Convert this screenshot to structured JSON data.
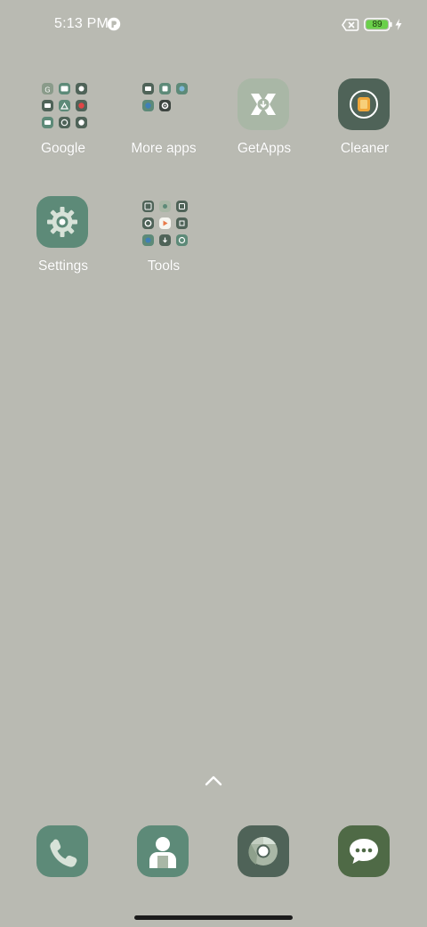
{
  "status_bar": {
    "time": "5:13 PM",
    "battery_level": "89",
    "icons": [
      "notification-icon",
      "no-sim-icon",
      "battery-icon",
      "charging-icon"
    ]
  },
  "home": {
    "apps": [
      {
        "label": "Google",
        "icon": "google-folder-icon",
        "type": "folder"
      },
      {
        "label": "More apps",
        "icon": "more-apps-folder-icon",
        "type": "folder"
      },
      {
        "label": "GetApps",
        "icon": "getapps-icon",
        "type": "app"
      },
      {
        "label": "Cleaner",
        "icon": "cleaner-icon",
        "type": "app"
      },
      {
        "label": "Settings",
        "icon": "settings-icon",
        "type": "app"
      },
      {
        "label": "Tools",
        "icon": "tools-folder-icon",
        "type": "folder"
      }
    ],
    "app_drawer_hint": "chevron-up-icon"
  },
  "dock": {
    "apps": [
      {
        "name": "Phone",
        "icon": "phone-icon"
      },
      {
        "name": "Contacts",
        "icon": "contacts-icon"
      },
      {
        "name": "Chrome",
        "icon": "chrome-icon"
      },
      {
        "name": "Messages",
        "icon": "messages-icon"
      }
    ]
  },
  "colors": {
    "wallpaper": "#b9bab2",
    "icon_green": "#5d8a78",
    "icon_dark": "#4f6358",
    "icon_light": "#a9b7a6",
    "battery_fill": "#6ad04a"
  }
}
